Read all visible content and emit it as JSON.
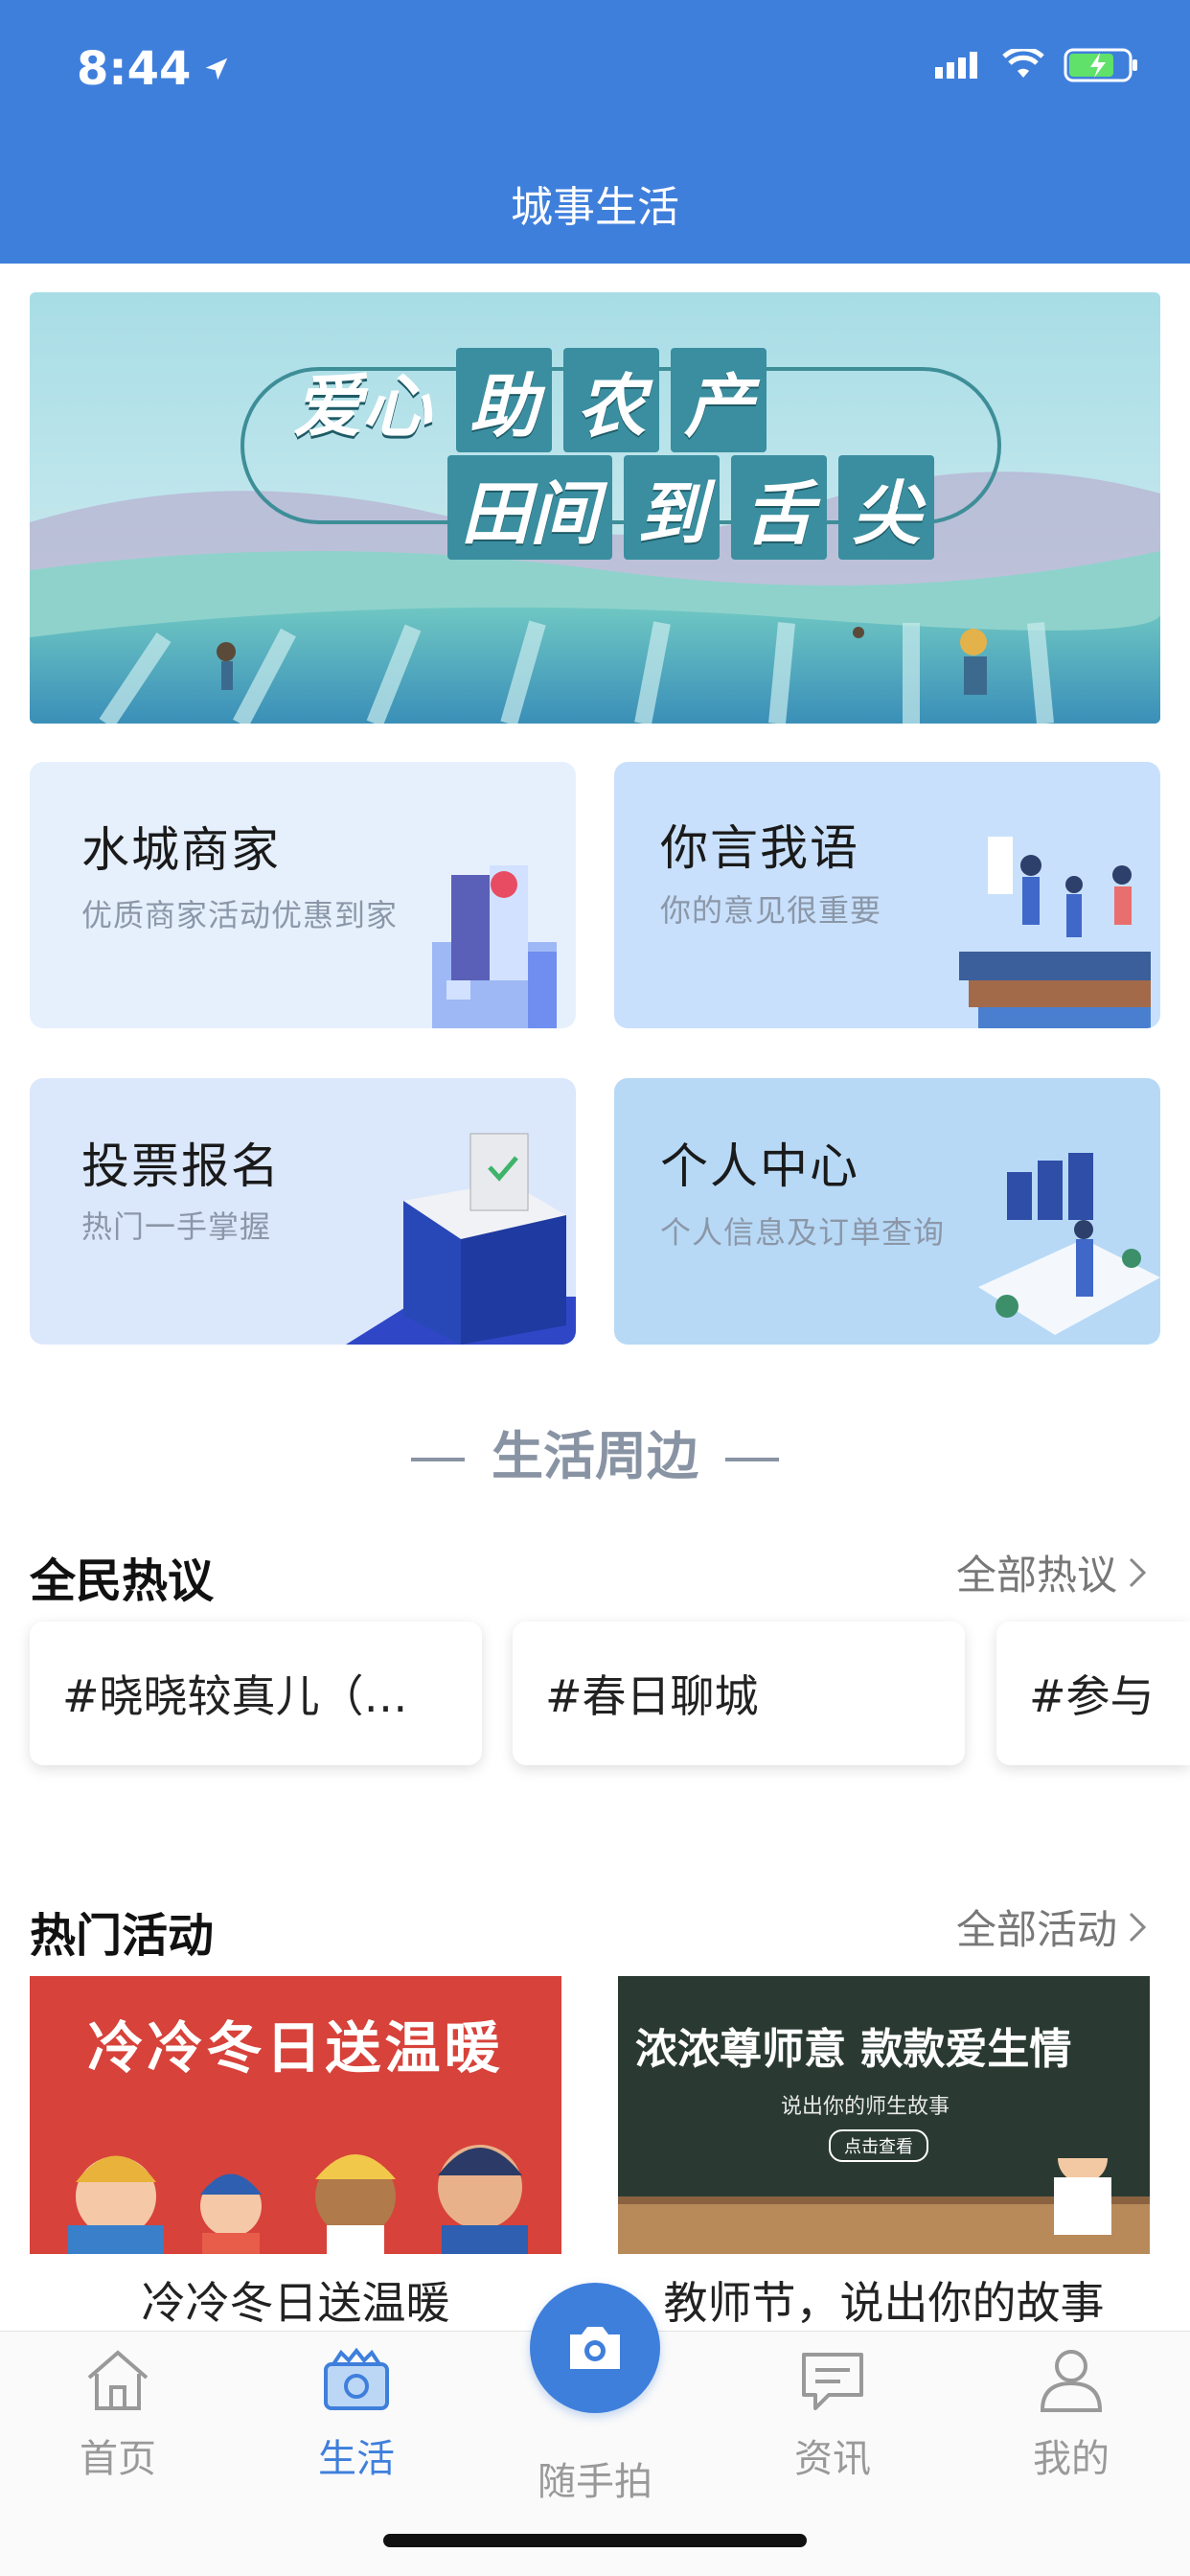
{
  "status_bar": {
    "time": "8:44"
  },
  "header": {
    "title": "城事生活"
  },
  "banner": {
    "line1": [
      "爱心",
      "助",
      "农",
      "产"
    ],
    "line2": [
      "田间",
      "到",
      "舌",
      "尖"
    ]
  },
  "cards": [
    {
      "title": "水城商家",
      "subtitle": "优质商家活动优惠到家"
    },
    {
      "title": "你言我语",
      "subtitle": "你的意见很重要"
    },
    {
      "title": "投票报名",
      "subtitle": "热门一手掌握"
    },
    {
      "title": "个人中心",
      "subtitle": "个人信息及订单查询"
    }
  ],
  "section": {
    "title": "生活周边"
  },
  "discussion": {
    "title": "全民热议",
    "link": "全部热议",
    "topics": [
      "#晓晓较真儿（…",
      "#春日聊城",
      "#参与"
    ]
  },
  "activities": {
    "title": "热门活动",
    "link": "全部活动",
    "items": [
      {
        "caption": "冷冷冬日送温暖",
        "image_text": "冷冷冬日送温暖"
      },
      {
        "caption": "教师节，说出你的故事",
        "image_text": "浓浓尊师意  款款爱生情",
        "image_sub": "说出你的师生故事",
        "image_button": "点击查看"
      }
    ]
  },
  "tabs": [
    {
      "label": "首页",
      "icon": "home-icon",
      "active": false
    },
    {
      "label": "生活",
      "icon": "camera-bag-icon",
      "active": true
    },
    {
      "label": "随手拍",
      "icon": "camera-icon",
      "active": false
    },
    {
      "label": "资讯",
      "icon": "chat-icon",
      "active": false
    },
    {
      "label": "我的",
      "icon": "user-icon",
      "active": false
    }
  ],
  "colors": {
    "primary": "#3f7fdc",
    "muted": "#8893a3"
  }
}
